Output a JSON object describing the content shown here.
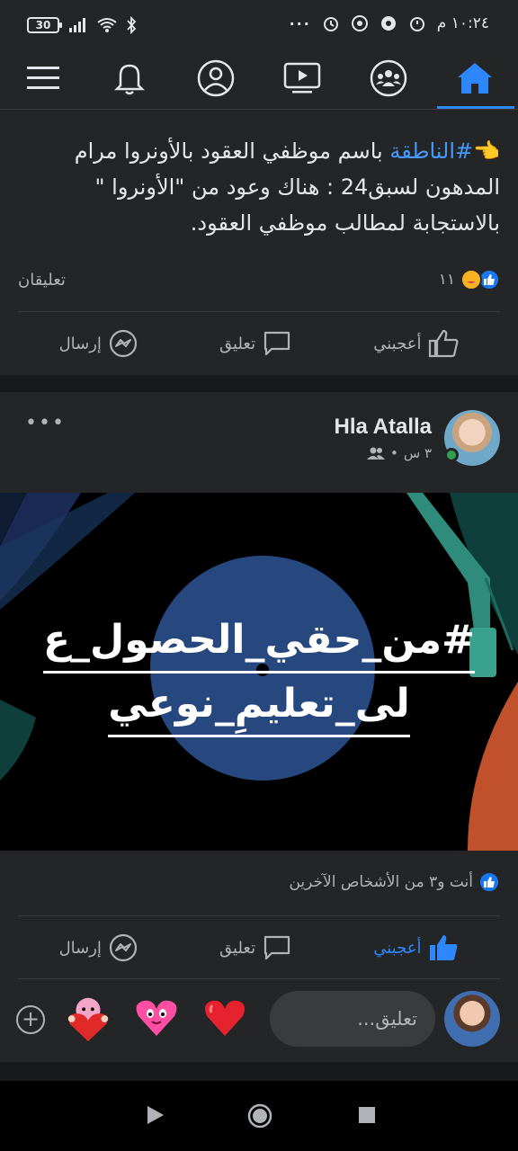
{
  "status_bar": {
    "battery": "30",
    "time": "١٠:٢٤ م",
    "dots": "···"
  },
  "nav": {
    "tabs": [
      {
        "name": "menu",
        "icon": "hamburger-menu-icon"
      },
      {
        "name": "notifications",
        "icon": "bell-icon"
      },
      {
        "name": "profile",
        "icon": "profile-icon"
      },
      {
        "name": "watch",
        "icon": "video-icon"
      },
      {
        "name": "groups",
        "icon": "groups-icon"
      },
      {
        "name": "home",
        "icon": "home-icon",
        "active": true
      }
    ],
    "accent": "#2d88ff"
  },
  "post1": {
    "emoji": "👈",
    "hashtag": "#الناطقة",
    "text": " باسم موظفي العقود بالأونروا مرام المدهون لسبق24 : هناك وعود من \"الأونروا \" بالاستجابة لمطالب موظفي العقود.",
    "reaction_count": "١١",
    "comments": "تعليقان",
    "actions": {
      "like": "أعجبني",
      "comment": "تعليق",
      "send": "إرسال"
    }
  },
  "post2": {
    "author": "Hla Atalla",
    "time": "٣ س",
    "separator": "•",
    "image_text_line1": "#من_حقي_الحصول_ع",
    "image_text_line2": "لى_تعليمِ_نوعي",
    "reactions_text": "أنت و٣ من الأشخاص الآخرين",
    "actions": {
      "like": "أعجبني",
      "comment": "تعليق",
      "send": "إرسال"
    },
    "comment_placeholder": "تعليق..."
  },
  "colors": {
    "background": "#18191a",
    "card": "#242526",
    "link": "#4599ff",
    "like": "#1877f2"
  }
}
